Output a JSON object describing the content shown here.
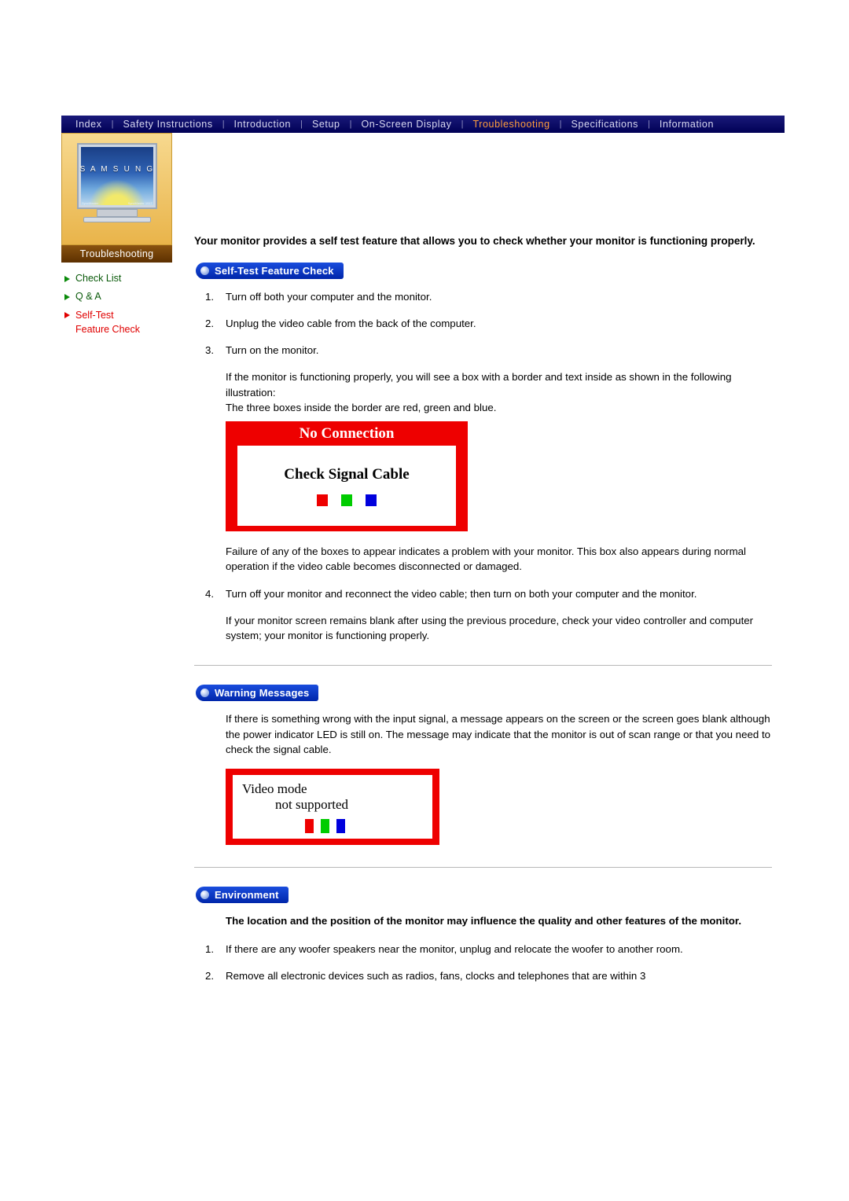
{
  "nav": {
    "items": [
      {
        "label": "Index",
        "active": false
      },
      {
        "label": "Safety Instructions",
        "active": false
      },
      {
        "label": "Introduction",
        "active": false
      },
      {
        "label": "Setup",
        "active": false
      },
      {
        "label": "On-Screen Display",
        "active": false
      },
      {
        "label": "Troubleshooting",
        "active": true
      },
      {
        "label": "Specifications",
        "active": false
      },
      {
        "label": "Information",
        "active": false
      }
    ],
    "separator": "|"
  },
  "sidebar": {
    "brand": "S A M S U N G",
    "screen_left_label": "SyncMaster",
    "screen_right_label": "SyncMaster 191T",
    "section_title": "Troubleshooting",
    "items": [
      {
        "label": "Check List",
        "current": false
      },
      {
        "label": "Q & A",
        "current": false
      },
      {
        "label": "Self-Test\nFeature Check",
        "current": true
      }
    ]
  },
  "main": {
    "intro": "Your monitor provides a self test feature that allows you to check whether your monitor is functioning properly.",
    "self_test": {
      "heading": "Self-Test Feature Check",
      "steps": [
        {
          "num": "1.",
          "text": "Turn off both your computer and the monitor."
        },
        {
          "num": "2.",
          "text": "Unplug the video cable from the back of the computer."
        },
        {
          "num": "3.",
          "text": "Turn on the monitor."
        }
      ],
      "para_after_3": "If the monitor is functioning properly, you will see a box with a border and text inside as shown in the following illustration:\nThe three boxes inside the border are red, green and blue.",
      "graphic": {
        "title": "No Connection",
        "message": "Check Signal Cable",
        "colors": [
          "#ee0000",
          "#00cc00",
          "#0000dd"
        ]
      },
      "para_after_graphic": "Failure of any of the boxes to appear indicates a problem with your monitor. This box also appears during normal operation if the video cable becomes disconnected or damaged.",
      "step4": {
        "num": "4.",
        "text": "Turn off your monitor and reconnect the video cable; then turn on both your computer and the monitor."
      },
      "para_end": "If your monitor screen remains blank after using the previous procedure, check your video controller and computer system; your monitor is functioning properly."
    },
    "warning": {
      "heading": "Warning Messages",
      "body": "If there is something wrong with the input signal, a message appears on the screen or the screen goes blank although the power indicator LED is still on. The message may indicate that the monitor is out of scan range or that you need to check the signal cable.",
      "graphic": {
        "line1": "Video mode",
        "line2": "not supported",
        "colors": [
          "#ee0000",
          "#00cc00",
          "#0000dd"
        ]
      }
    },
    "environment": {
      "heading": "Environment",
      "subheading": "The location and the position of the monitor may influence the quality and other features of the monitor.",
      "steps": [
        {
          "num": "1.",
          "text": "If there are any woofer speakers near the monitor, unplug and relocate the woofer to another room."
        },
        {
          "num": "2.",
          "text": "Remove all electronic devices such as radios, fans, clocks and telephones that are within 3"
        }
      ]
    }
  }
}
